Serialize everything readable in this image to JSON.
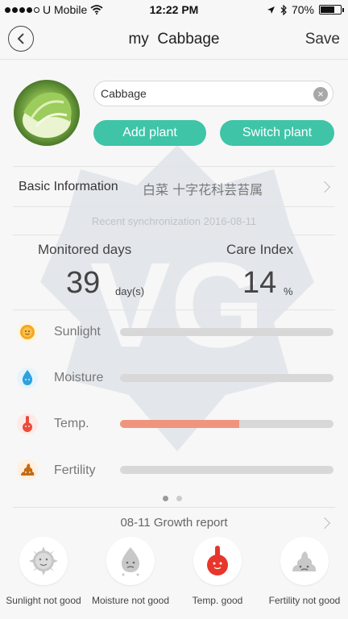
{
  "status_bar": {
    "carrier": "U Mobile",
    "time": "12:22 PM",
    "battery": "70%",
    "signal_bars_filled": 4,
    "battery_level": 0.7
  },
  "header": {
    "title": "my  Cabbage",
    "save_label": "Save",
    "back_icon": "chevron-left-icon"
  },
  "plant": {
    "name_value": "Cabbage",
    "add_plant_label": "Add plant",
    "switch_plant_label": "Switch plant"
  },
  "basic_info": {
    "label": "Basic Information",
    "value": "白菜 十字花科芸苔属"
  },
  "sync": {
    "text": "Recent synchronization 2016-08-11"
  },
  "stats": {
    "monitored_days_label": "Monitored days",
    "monitored_days_value": "39",
    "monitored_days_unit": "day(s)",
    "care_index_label": "Care Index",
    "care_index_value": "14",
    "care_index_unit": "%"
  },
  "meters": [
    {
      "label": "Sunlight",
      "icon": "sun-icon",
      "level": 0
    },
    {
      "label": "Moisture",
      "icon": "water-drop-icon",
      "level": 0
    },
    {
      "label": "Temp.",
      "icon": "thermometer-icon",
      "level": 0.56
    },
    {
      "label": "Fertility",
      "icon": "fertility-icon",
      "level": 0
    }
  ],
  "pagination": {
    "pages": 2,
    "active": 0
  },
  "growth_report": {
    "title": "08-11 Growth report",
    "items": [
      {
        "label": "Sunlight not good",
        "icon": "sun-face-icon"
      },
      {
        "label": "Moisture not good",
        "icon": "drop-face-icon"
      },
      {
        "label": "Temp. good",
        "icon": "thermometer-face-icon"
      },
      {
        "label": "Fertility not good",
        "icon": "fertility-face-icon"
      }
    ]
  },
  "colors": {
    "accent": "#3fc4a8",
    "temp_fill": "#f0957d",
    "track": "#d8d8d8"
  }
}
